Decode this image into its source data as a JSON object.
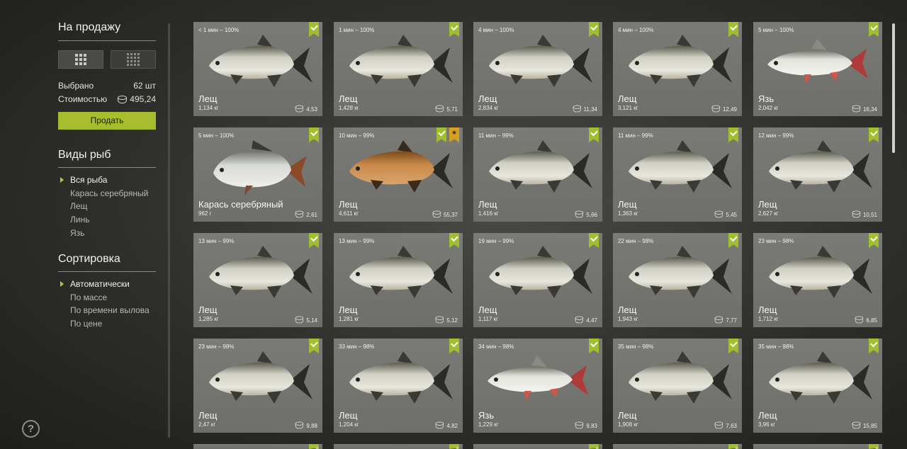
{
  "sidebar": {
    "for_sale_title": "На продажу",
    "selected_label": "Выбрано",
    "selected_value": "62 шт",
    "cost_label": "Стоимостью",
    "cost_value": "495,24",
    "sell_label": "Продать",
    "fish_types_title": "Виды рыб",
    "fish_types": [
      {
        "label": "Вся рыба",
        "active": true
      },
      {
        "label": "Карась серебряный",
        "active": false
      },
      {
        "label": "Лещ",
        "active": false
      },
      {
        "label": "Линь",
        "active": false
      },
      {
        "label": "Язь",
        "active": false
      }
    ],
    "sort_title": "Сортировка",
    "sort_options": [
      {
        "label": "Автоматически",
        "active": true
      },
      {
        "label": "По массе",
        "active": false
      },
      {
        "label": "По времени вылова",
        "active": false
      },
      {
        "label": "По цене",
        "active": false
      }
    ],
    "help_label": "?"
  },
  "colors": {
    "accent": "#a7bd2e",
    "favorite": "#d6a11e"
  },
  "cards": [
    {
      "time": "< 1 мин – 100%",
      "name": "Лещ",
      "weight": "1,134 кг",
      "price": "4,53",
      "species": "bream",
      "favorite": false
    },
    {
      "time": "1 мин – 100%",
      "name": "Лещ",
      "weight": "1,428 кг",
      "price": "5,71",
      "species": "bream",
      "favorite": false
    },
    {
      "time": "4 мин – 100%",
      "name": "Лещ",
      "weight": "2,834 кг",
      "price": "11,34",
      "species": "bream",
      "favorite": false
    },
    {
      "time": "4 мин – 100%",
      "name": "Лещ",
      "weight": "3,121 кг",
      "price": "12,49",
      "species": "bream",
      "favorite": false
    },
    {
      "time": "5 мин – 100%",
      "name": "Язь",
      "weight": "2,042 кг",
      "price": "16,34",
      "species": "ide",
      "favorite": false
    },
    {
      "time": "5 мин – 100%",
      "name": "Карась серебряный",
      "weight": "962 г",
      "price": "2,61",
      "species": "carp",
      "favorite": false
    },
    {
      "time": "10 мин – 99%",
      "name": "Лещ",
      "weight": "4,611 кг",
      "price": "55,37",
      "species": "golden",
      "favorite": true
    },
    {
      "time": "11 мин – 99%",
      "name": "Лещ",
      "weight": "1,416 кг",
      "price": "5,66",
      "species": "bream",
      "favorite": false
    },
    {
      "time": "11 мин – 99%",
      "name": "Лещ",
      "weight": "1,363 кг",
      "price": "5,45",
      "species": "bream",
      "favorite": false
    },
    {
      "time": "12 мин – 99%",
      "name": "Лещ",
      "weight": "2,627 кг",
      "price": "10,51",
      "species": "bream",
      "favorite": false
    },
    {
      "time": "13 мин – 99%",
      "name": "Лещ",
      "weight": "1,285 кг",
      "price": "5,14",
      "species": "bream",
      "favorite": false
    },
    {
      "time": "13 мин – 99%",
      "name": "Лещ",
      "weight": "1,281 кг",
      "price": "5,12",
      "species": "bream",
      "favorite": false
    },
    {
      "time": "19 мин – 99%",
      "name": "Лещ",
      "weight": "1,117 кг",
      "price": "4,47",
      "species": "bream",
      "favorite": false
    },
    {
      "time": "22 мин – 98%",
      "name": "Лещ",
      "weight": "1,943 кг",
      "price": "7,77",
      "species": "bream",
      "favorite": false
    },
    {
      "time": "23 мин – 98%",
      "name": "Лещ",
      "weight": "1,712 кг",
      "price": "6,85",
      "species": "bream",
      "favorite": false
    },
    {
      "time": "23 мин – 98%",
      "name": "Лещ",
      "weight": "2,47 кг",
      "price": "9,88",
      "species": "bream",
      "favorite": false
    },
    {
      "time": "33 мин – 98%",
      "name": "Лещ",
      "weight": "1,204 кг",
      "price": "4,82",
      "species": "bream",
      "favorite": false
    },
    {
      "time": "34 мин – 98%",
      "name": "Язь",
      "weight": "1,229 кг",
      "price": "9,83",
      "species": "ide",
      "favorite": false
    },
    {
      "time": "35 мин – 98%",
      "name": "Лещ",
      "weight": "1,908 кг",
      "price": "7,63",
      "species": "bream",
      "favorite": false
    },
    {
      "time": "35 мин – 98%",
      "name": "Лещ",
      "weight": "3,96 кг",
      "price": "15,85",
      "species": "bream",
      "favorite": false
    }
  ],
  "icons": {
    "check": "check-ribbon-icon",
    "star": "star-ribbon-icon",
    "coin": "coin-stack-icon"
  }
}
